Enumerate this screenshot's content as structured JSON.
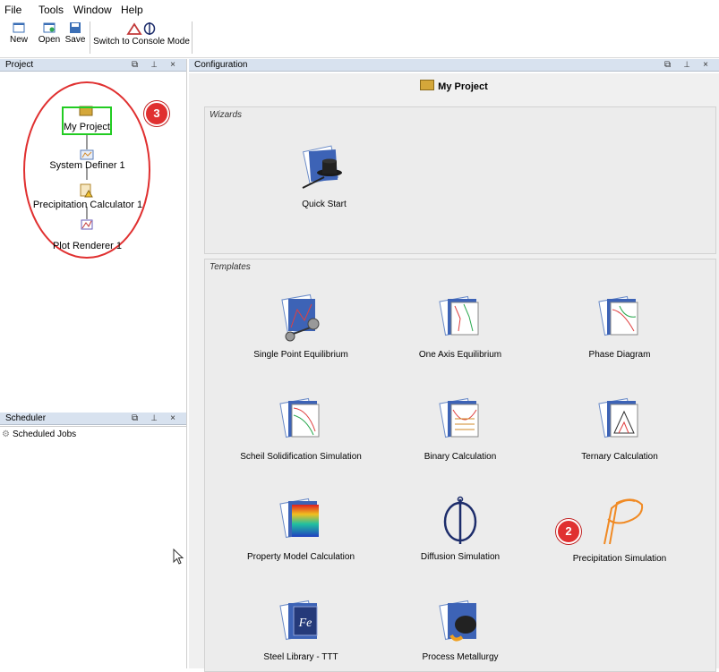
{
  "menu": {
    "file": "File",
    "tools": "Tools",
    "window": "Window",
    "help": "Help"
  },
  "toolbar": {
    "new_label": "New",
    "open_label": "Open",
    "save_label": "Save",
    "console_label": "Switch to Console Mode"
  },
  "project_panel": {
    "title": "Project",
    "tree": [
      "My Project",
      "System Definer 1",
      "Precipitation Calculator 1",
      "Plot Renderer 1"
    ],
    "badge": "3"
  },
  "scheduler_panel": {
    "title": "Scheduler",
    "item": "Scheduled Jobs"
  },
  "configuration_panel": {
    "title": "Configuration",
    "project_title": "My Project",
    "wizards_label": "Wizards",
    "wizards": [
      "Quick Start"
    ],
    "templates_label": "Templates",
    "templates": [
      "Single Point Equilibrium",
      "One Axis Equilibrium",
      "Phase Diagram",
      "Scheil Solidification Simulation",
      "Binary Calculation",
      "Ternary Calculation",
      "Property Model Calculation",
      "Diffusion Simulation",
      "Precipitation Simulation",
      "Steel Library - TTT",
      "Process Metallurgy"
    ],
    "badge": "2"
  },
  "colors": {
    "accent_red": "#e03030",
    "selected_green": "#22cc22",
    "header_blue": "#d8e2ef",
    "diffusion_navy": "#1d2d6b",
    "precip_orange": "#f08a24"
  }
}
